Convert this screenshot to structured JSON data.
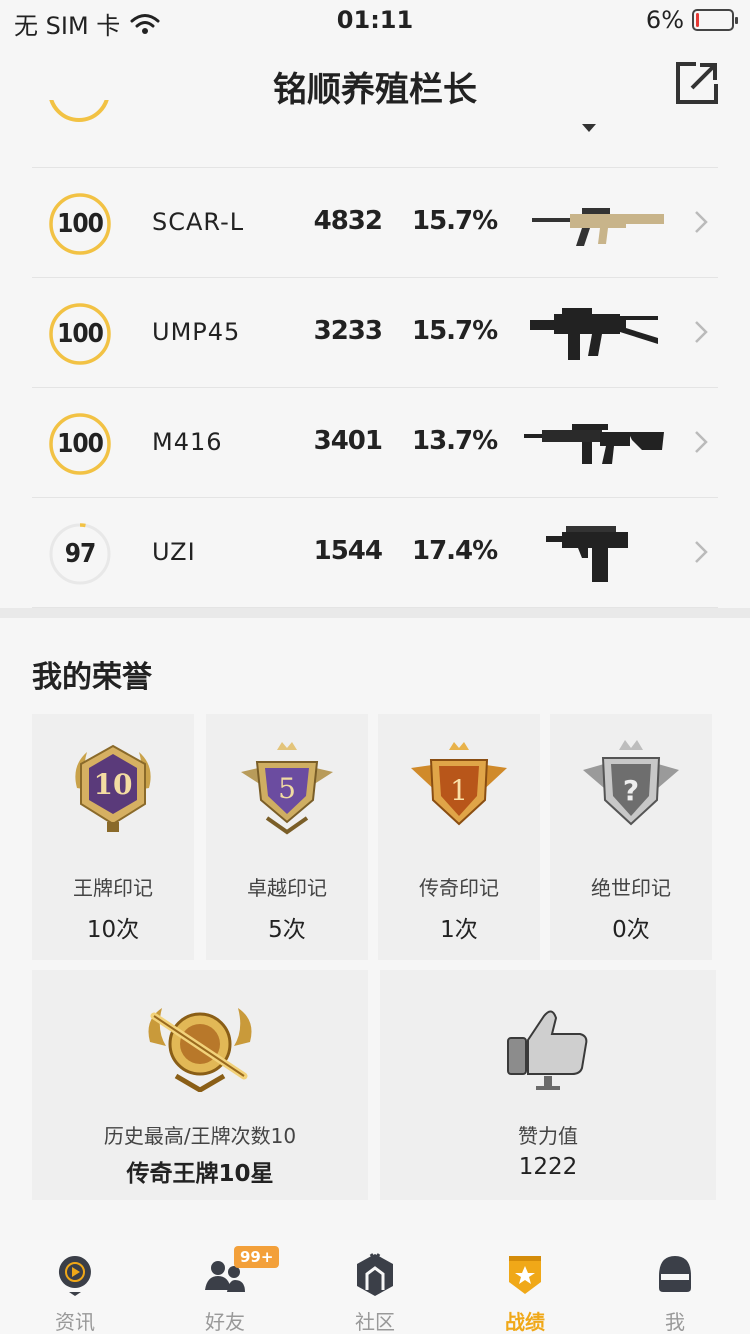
{
  "status_bar": {
    "carrier": "无 SIM 卡",
    "time": "01:11",
    "battery_text": "6%",
    "battery_level": 0.06
  },
  "header": {
    "title": "铭顺养殖栏长"
  },
  "weapons": [
    {
      "score": "100",
      "score_pct": 1.0,
      "name": "SCAR-L",
      "kills": "4832",
      "rate": "15.7%",
      "icon": "assault-rifle-scar"
    },
    {
      "score": "100",
      "score_pct": 1.0,
      "name": "UMP45",
      "kills": "3233",
      "rate": "15.7%",
      "icon": "smg-ump45"
    },
    {
      "score": "100",
      "score_pct": 1.0,
      "name": "M416",
      "kills": "3401",
      "rate": "13.7%",
      "icon": "assault-rifle-m416"
    },
    {
      "score": "97",
      "score_pct": 0.03,
      "name": "UZI",
      "kills": "1544",
      "rate": "17.4%",
      "icon": "smg-uzi"
    }
  ],
  "honor": {
    "title": "我的荣誉",
    "badges": [
      {
        "label": "王牌印记",
        "count": "10次",
        "icon": "ace-seal-icon"
      },
      {
        "label": "卓越印记",
        "count": "5次",
        "icon": "excellence-seal-icon"
      },
      {
        "label": "传奇印记",
        "count": "1次",
        "icon": "legend-seal-icon"
      },
      {
        "label": "绝世印记",
        "count": "0次",
        "icon": "peerless-seal-icon"
      }
    ],
    "highest": {
      "label": "历史最高/王牌次数10",
      "value": "传奇王牌10星"
    },
    "likes": {
      "label": "赞力值",
      "value": "1222"
    }
  },
  "bottom_nav": [
    {
      "label": "资讯",
      "icon": "news-icon"
    },
    {
      "label": "好友",
      "icon": "friends-icon",
      "badge": "99+"
    },
    {
      "label": "社区",
      "icon": "community-icon"
    },
    {
      "label": "战绩",
      "icon": "record-icon",
      "active": true
    },
    {
      "label": "我",
      "icon": "profile-icon"
    }
  ],
  "colors": {
    "accent": "#f0a818",
    "ring": "#f2c244",
    "ring_track": "#e8e8e8",
    "badge": "#f3a03a"
  }
}
